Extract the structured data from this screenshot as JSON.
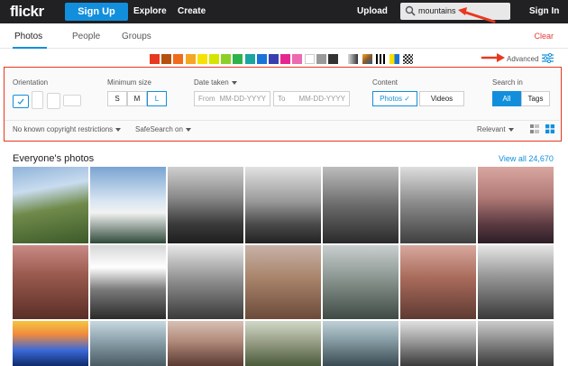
{
  "header": {
    "logo": "flickr",
    "signup_label": "Sign Up",
    "explore_label": "Explore",
    "create_label": "Create",
    "upload_label": "Upload",
    "search_value": "mountains",
    "signin_label": "Sign In"
  },
  "subnav": {
    "tabs": [
      {
        "label": "Photos"
      },
      {
        "label": "People"
      },
      {
        "label": "Groups"
      }
    ],
    "clear_label": "Clear"
  },
  "swatches": [
    "#e8381f",
    "#b5510d",
    "#f06b1c",
    "#f5a623",
    "#f6e200",
    "#d4e600",
    "#8ccf29",
    "#2db34a",
    "#19a6a0",
    "#1a73d9",
    "#3a3fb0",
    "#e6268f",
    "#ec6ab0",
    "#ffffff",
    "#999999",
    "#333333"
  ],
  "advanced_label": "Advanced",
  "filters": {
    "orientation_label": "Orientation",
    "min_size_label": "Minimum size",
    "sizes": [
      "S",
      "M",
      "L"
    ],
    "date_label": "Date taken",
    "from_label": "From",
    "to_label": "To",
    "date_placeholder": "MM-DD-YYYY",
    "content_label": "Content",
    "content_photos": "Photos",
    "content_videos": "Videos",
    "search_in_label": "Search in",
    "search_all": "All",
    "search_tags": "Tags",
    "license_label": "No known copyright restrictions",
    "safesearch_label": "SafeSearch on",
    "sort_label": "Relevant"
  },
  "results": {
    "title": "Everyone's photos",
    "view_all": "View all 24,670"
  }
}
